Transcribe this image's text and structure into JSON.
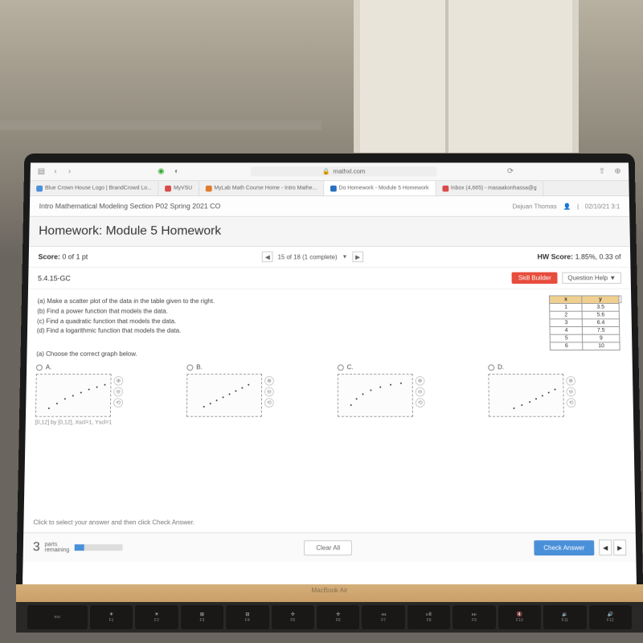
{
  "browser": {
    "url": "mathxl.com",
    "tabs": [
      {
        "label": "Blue Crown House Logo | BrandCrowd Lo...",
        "color": "#4a90d9"
      },
      {
        "label": "MyVSU",
        "color": "#d94a4a"
      },
      {
        "label": "MyLab Math Course Home - Intro Mathe...",
        "color": "#e07b2a"
      },
      {
        "label": "Do Homework - Module 5 Homework",
        "color": "#2a70c0",
        "active": true
      },
      {
        "label": "Inbox (4,665) - masaakonhassa@g",
        "color": "#d94a4a"
      }
    ]
  },
  "header": {
    "course": "Intro Mathematical Modeling Section P02 Spring 2021 CO",
    "user": "Dejuan Thomas",
    "datetime": "02/10/21 3:1"
  },
  "assignment": {
    "title": "Homework: Module 5 Homework",
    "score_label": "Score:",
    "score_value": "0 of 1 pt",
    "pager": "15 of 18 (1 complete)",
    "hw_score_label": "HW Score:",
    "hw_score_value": "1.85%, 0.33 of",
    "question_id": "5.4.15-GC",
    "skill_builder": "Skill Builder",
    "question_help": "Question Help ▼"
  },
  "question": {
    "a": "(a) Make a scatter plot of the data in the table given to the right.",
    "b": "(b) Find a power function that models the data.",
    "c": "(c) Find a quadratic function that models the data.",
    "d": "(d) Find a logarithmic function that models the data.",
    "choose": "(a) Choose the correct graph below.",
    "caption": "[0,12] by [0,12], Xscl=1, Yscl=1"
  },
  "table": {
    "headers": [
      "x",
      "y"
    ],
    "rows": [
      [
        "1",
        "3.5"
      ],
      [
        "2",
        "5.6"
      ],
      [
        "3",
        "6.4"
      ],
      [
        "4",
        "7.5"
      ],
      [
        "5",
        "9"
      ],
      [
        "6",
        "10"
      ]
    ]
  },
  "options": [
    "A.",
    "B.",
    "C.",
    "D."
  ],
  "footer": {
    "hint": "Click to select your answer and then click Check Answer.",
    "parts_num": "3",
    "parts_label": "parts\nremaining",
    "clear": "Clear All",
    "check": "Check Answer"
  },
  "laptop": {
    "model": "MacBook Air",
    "keys": [
      {
        "main": "esc"
      },
      {
        "main": "F1",
        "icon": "☀"
      },
      {
        "main": "F2",
        "icon": "☀"
      },
      {
        "main": "F3",
        "icon": "⊞"
      },
      {
        "main": "F4",
        "icon": "⊟"
      },
      {
        "main": "F5",
        "icon": "✢"
      },
      {
        "main": "F6",
        "icon": "✢"
      },
      {
        "main": "F7",
        "icon": "◃◃"
      },
      {
        "main": "F8",
        "icon": "▹II"
      },
      {
        "main": "F9",
        "icon": "▹▹"
      },
      {
        "main": "F10",
        "icon": "🔇"
      },
      {
        "main": "F11",
        "icon": "🔉"
      },
      {
        "main": "F12",
        "icon": "🔊"
      }
    ]
  }
}
